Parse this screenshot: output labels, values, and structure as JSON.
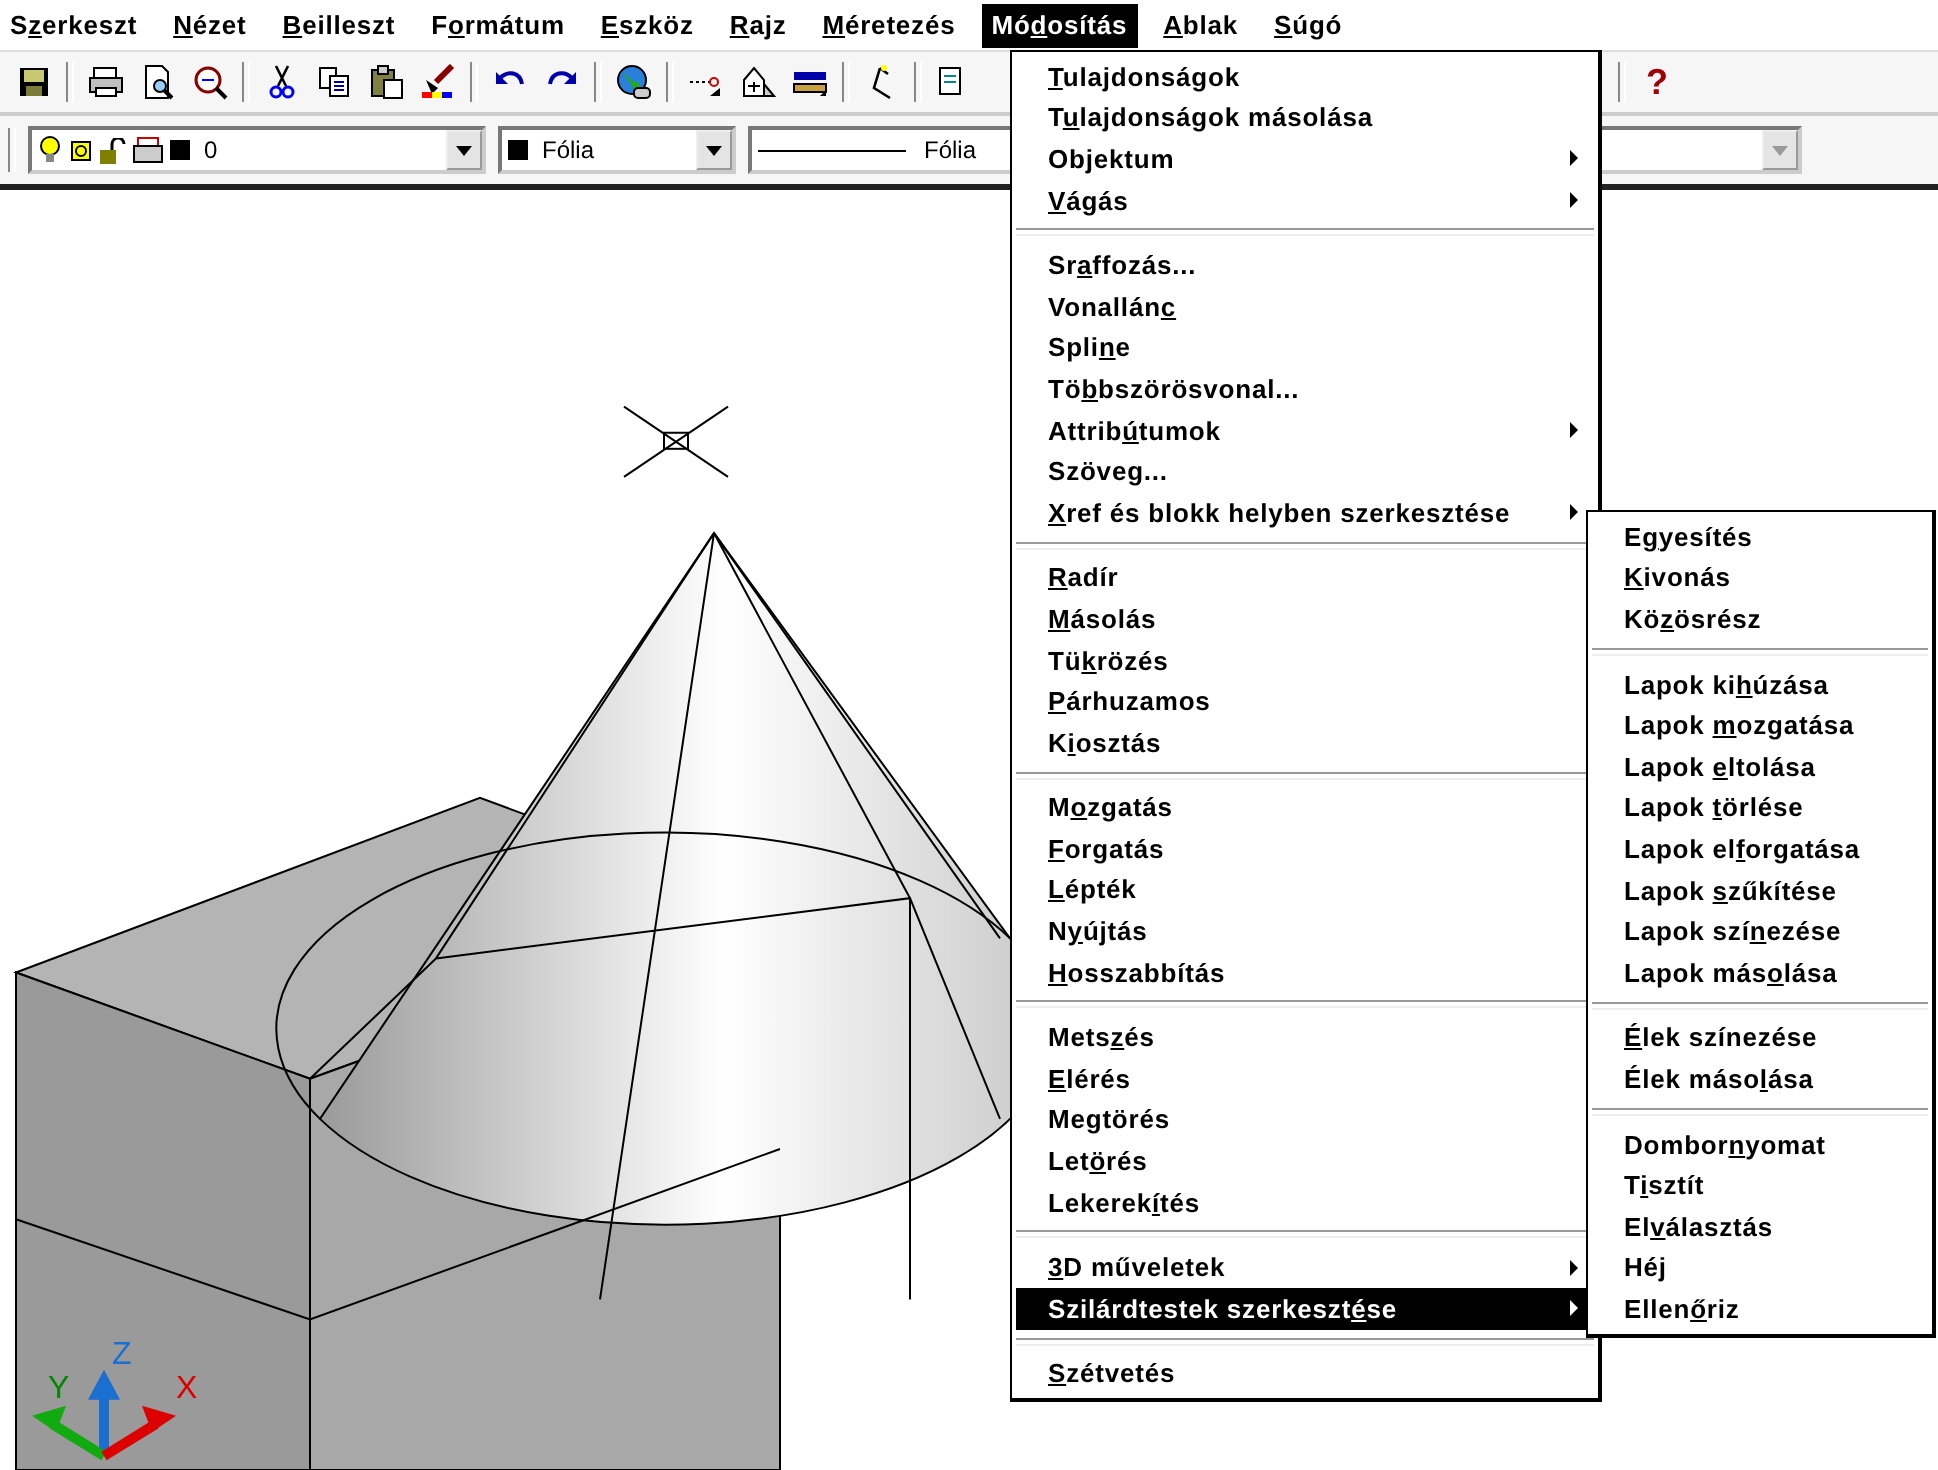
{
  "menubar": [
    {
      "label": {
        "pre": "S",
        "key": "z",
        "post": "erkeszt"
      },
      "selected": false
    },
    {
      "label": {
        "key": "N",
        "post": "ézet"
      },
      "selected": false
    },
    {
      "label": {
        "key": "B",
        "post": "eilleszt"
      },
      "selected": false
    },
    {
      "label": {
        "pre": "F",
        "key": "o",
        "post": "rmátum"
      },
      "selected": false
    },
    {
      "label": {
        "key": "E",
        "post": "szköz"
      },
      "selected": false
    },
    {
      "label": {
        "key": "R",
        "post": "ajz"
      },
      "selected": false
    },
    {
      "label": {
        "key": "M",
        "post": "éretezés"
      },
      "selected": false
    },
    {
      "label": {
        "pre": "Mó",
        "key": "d",
        "post": "osítás"
      },
      "selected": true
    },
    {
      "label": {
        "key": "A",
        "post": "blak"
      },
      "selected": false
    },
    {
      "label": {
        "key": "S",
        "post": "úgó"
      },
      "selected": false
    }
  ],
  "toolbar": {
    "help": "?"
  },
  "layer_bar": {
    "layer": "0",
    "color_name": "Fólia",
    "linetype": "Fólia"
  },
  "menu": [
    {
      "kind": "item",
      "label": {
        "key": "T",
        "post": "ulajdonságok"
      },
      "submenu": false,
      "selected": false
    },
    {
      "kind": "item",
      "label": {
        "pre": "T",
        "key": "u",
        "post": "lajdonságok másolása"
      },
      "submenu": false,
      "selected": false
    },
    {
      "kind": "item",
      "label": {
        "pre": "Objektum"
      },
      "submenu": true,
      "selected": false
    },
    {
      "kind": "item",
      "label": {
        "key": "V",
        "post": "ágás"
      },
      "submenu": true,
      "selected": false
    },
    {
      "kind": "separator"
    },
    {
      "kind": "item",
      "label": {
        "pre": "Sr",
        "key": "a",
        "post": "ffozás..."
      },
      "submenu": false,
      "selected": false
    },
    {
      "kind": "item",
      "label": {
        "pre": "Vonallán",
        "key": "c"
      },
      "submenu": false,
      "selected": false
    },
    {
      "kind": "item",
      "label": {
        "pre": "Spli",
        "key": "n",
        "post": "e"
      },
      "submenu": false,
      "selected": false
    },
    {
      "kind": "item",
      "label": {
        "pre": "Tö",
        "key": "b",
        "post": "bszörösvonal..."
      },
      "submenu": false,
      "selected": false
    },
    {
      "kind": "item",
      "label": {
        "pre": "Attrib",
        "key": "ú",
        "post": "tumok"
      },
      "submenu": true,
      "selected": false
    },
    {
      "kind": "item",
      "label": {
        "pre": "Szöveg..."
      },
      "submenu": false,
      "selected": false
    },
    {
      "kind": "item",
      "label": {
        "key": "X",
        "post": "ref és blokk helyben szerkesztése"
      },
      "submenu": true,
      "selected": false
    },
    {
      "kind": "separator"
    },
    {
      "kind": "item",
      "label": {
        "key": "R",
        "post": "adír"
      },
      "submenu": false,
      "selected": false
    },
    {
      "kind": "item",
      "label": {
        "key": "M",
        "post": "ásolás"
      },
      "submenu": false,
      "selected": false
    },
    {
      "kind": "item",
      "label": {
        "pre": "Tü",
        "key": "k",
        "post": "rözés"
      },
      "submenu": false,
      "selected": false
    },
    {
      "kind": "item",
      "label": {
        "key": "P",
        "post": "árhuzamos"
      },
      "submenu": false,
      "selected": false
    },
    {
      "kind": "item",
      "label": {
        "pre": "K",
        "key": "i",
        "post": "osztás"
      },
      "submenu": false,
      "selected": false
    },
    {
      "kind": "separator"
    },
    {
      "kind": "item",
      "label": {
        "pre": "M",
        "key": "o",
        "post": "zgatás"
      },
      "submenu": false,
      "selected": false
    },
    {
      "kind": "item",
      "label": {
        "key": "F",
        "post": "orgatás"
      },
      "submenu": false,
      "selected": false
    },
    {
      "kind": "item",
      "label": {
        "key": "L",
        "post": "épték"
      },
      "submenu": false,
      "selected": false
    },
    {
      "kind": "item",
      "label": {
        "pre": "N",
        "key": "y",
        "post": "újtás"
      },
      "submenu": false,
      "selected": false
    },
    {
      "kind": "item",
      "label": {
        "key": "H",
        "post": "osszabbítás"
      },
      "submenu": false,
      "selected": false
    },
    {
      "kind": "separator"
    },
    {
      "kind": "item",
      "label": {
        "pre": "Mets",
        "key": "z",
        "post": "és"
      },
      "submenu": false,
      "selected": false
    },
    {
      "kind": "item",
      "label": {
        "key": "E",
        "post": "lérés"
      },
      "submenu": false,
      "selected": false
    },
    {
      "kind": "item",
      "label": {
        "pre": "Megtörés"
      },
      "submenu": false,
      "selected": false
    },
    {
      "kind": "item",
      "label": {
        "pre": "Let",
        "key": "ö",
        "post": "rés"
      },
      "submenu": false,
      "selected": false
    },
    {
      "kind": "item",
      "label": {
        "pre": "Lekerek",
        "key": "í",
        "post": "tés"
      },
      "submenu": false,
      "selected": false
    },
    {
      "kind": "separator"
    },
    {
      "kind": "item",
      "label": {
        "key": "3",
        "post": "D műveletek"
      },
      "submenu": true,
      "selected": false
    },
    {
      "kind": "item",
      "label": {
        "pre": "Szilárdtestek szerkeszt",
        "key": "é",
        "post": "se"
      },
      "submenu": true,
      "selected": true
    },
    {
      "kind": "separator"
    },
    {
      "kind": "item",
      "label": {
        "key": "S",
        "post": "zétvetés"
      },
      "submenu": false,
      "selected": false
    }
  ],
  "submenu": [
    {
      "kind": "item",
      "label": {
        "pre": "E",
        "key": "g",
        "post": "yesítés"
      }
    },
    {
      "kind": "item",
      "label": {
        "key": "K",
        "post": "ivonás"
      }
    },
    {
      "kind": "item",
      "label": {
        "pre": "Kö",
        "key": "z",
        "post": "ösrész"
      }
    },
    {
      "kind": "separator"
    },
    {
      "kind": "item",
      "label": {
        "pre": "Lapok ki",
        "key": "h",
        "post": "úzása"
      }
    },
    {
      "kind": "item",
      "label": {
        "pre": "Lapok ",
        "key": "m",
        "post": "ozgatása"
      }
    },
    {
      "kind": "item",
      "label": {
        "pre": "Lapok ",
        "key": "e",
        "post": "ltolása"
      }
    },
    {
      "kind": "item",
      "label": {
        "pre": "Lapok ",
        "key": "t",
        "post": "örlése"
      }
    },
    {
      "kind": "item",
      "label": {
        "pre": "Lapok el",
        "key": "f",
        "post": "orgatása"
      }
    },
    {
      "kind": "item",
      "label": {
        "pre": "Lapok ",
        "key": "s",
        "post": "zűkítése"
      }
    },
    {
      "kind": "item",
      "label": {
        "pre": "Lapok szí",
        "key": "n",
        "post": "ezése"
      }
    },
    {
      "kind": "item",
      "label": {
        "pre": "Lapok más",
        "key": "o",
        "post": "lása"
      }
    },
    {
      "kind": "separator"
    },
    {
      "kind": "item",
      "label": {
        "key": "É",
        "post": "lek színezése"
      }
    },
    {
      "kind": "item",
      "label": {
        "pre": "Élek máso",
        "key": "l",
        "post": "ása"
      }
    },
    {
      "kind": "separator"
    },
    {
      "kind": "item",
      "label": {
        "pre": "Dombor",
        "key": "n",
        "post": "yomat"
      }
    },
    {
      "kind": "item",
      "label": {
        "pre": "T",
        "key": "i",
        "post": "sztít"
      }
    },
    {
      "kind": "item",
      "label": {
        "pre": "El",
        "key": "v",
        "post": "álasztás"
      }
    },
    {
      "kind": "item",
      "label": {
        "pre": "Héj"
      }
    },
    {
      "kind": "item",
      "label": {
        "pre": "Ellen",
        "key": "ő",
        "post": "riz"
      }
    }
  ],
  "ucs_icon": {
    "z_label": "Z",
    "y_label": "Y",
    "x_label": "X"
  }
}
